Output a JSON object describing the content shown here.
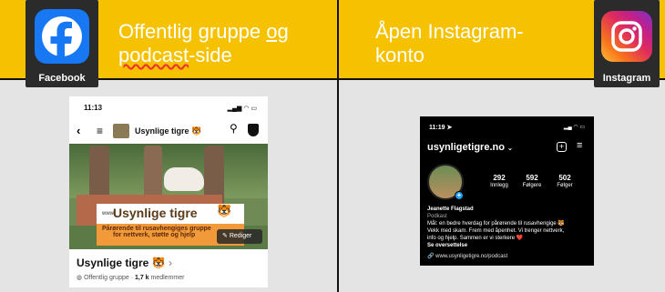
{
  "left_panel": {
    "title_line1_plain": "Offentlig gruppe ",
    "title_line1_underlined": "og",
    "title_line2_underlined": "podcast",
    "title_line2_rest": "-side",
    "app_label": "Facebook"
  },
  "right_panel": {
    "title_line1": "Åpen Instagram-",
    "title_line2": "konto",
    "app_label": "Instagram"
  },
  "facebook_phone": {
    "time": "11:13",
    "group_name_header": "Usynlige tigre 🐯",
    "banner_small": "www.",
    "banner_title": "Usynlige tigre",
    "banner_line1": "Pårørende til rusavhengiges gruppe",
    "banner_line2": "for nettverk, støtte og hjelp",
    "edit_button": "Rediger",
    "group_title": "Usynlige tigre 🐯",
    "group_title_chevron": "›",
    "privacy": "Offentlig gruppe",
    "dot": " · ",
    "members_count": "1,7 k",
    "members_label": " medlemmer"
  },
  "instagram_phone": {
    "time": "11:19",
    "username": "usynligetigre.no",
    "stats": [
      {
        "value": "292",
        "label": "Innlegg"
      },
      {
        "value": "592",
        "label": "Følgere"
      },
      {
        "value": "502",
        "label": "Følger"
      }
    ],
    "display_name": "Jeanette Flagstad",
    "category": "Podkast",
    "bio_line1": "Mål: en bedre hverdag for pårørende til rusavhengige 🐯",
    "bio_line2": "Vekk med skam. Frem med åpenhet. Vi trenger nettverk,",
    "bio_line3": "info og hjelp. Sammen er vi sterkere ❤️",
    "see_translation": "Se oversettelse",
    "link": "www.usynligetigre.no/podcast"
  },
  "colors": {
    "header_yellow": "#f6c200",
    "facebook_blue": "#1877f2",
    "banner_orange": "#f29a3a"
  }
}
